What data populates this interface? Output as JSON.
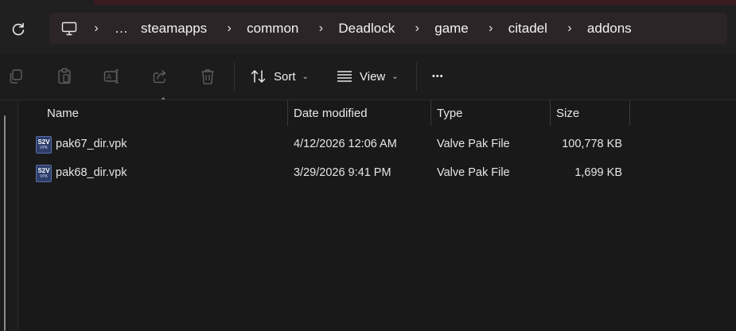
{
  "address": {
    "overflow": "…",
    "crumbs": [
      "steamapps",
      "common",
      "Deadlock",
      "game",
      "citadel",
      "addons"
    ],
    "separator": "›"
  },
  "toolbar": {
    "sort_label": "Sort",
    "view_label": "View",
    "more_label": "•••",
    "caret": "⌄"
  },
  "columns": {
    "name": "Name",
    "date": "Date modified",
    "type": "Type",
    "size": "Size"
  },
  "files": [
    {
      "name": "pak67_dir.vpk",
      "date": "4/12/2026 12:06 AM",
      "type": "Valve Pak File",
      "size": "100,778 KB",
      "icon_top": "S2V",
      "icon_bottom": "VPK"
    },
    {
      "name": "pak68_dir.vpk",
      "date": "3/29/2026 9:41 PM",
      "type": "Valve Pak File",
      "size": "1,699 KB",
      "icon_top": "S2V",
      "icon_bottom": "VPK"
    }
  ],
  "colors": {
    "background": "#191919",
    "address_bar": "#2b2527",
    "file_icon": "#2d3e6b"
  }
}
